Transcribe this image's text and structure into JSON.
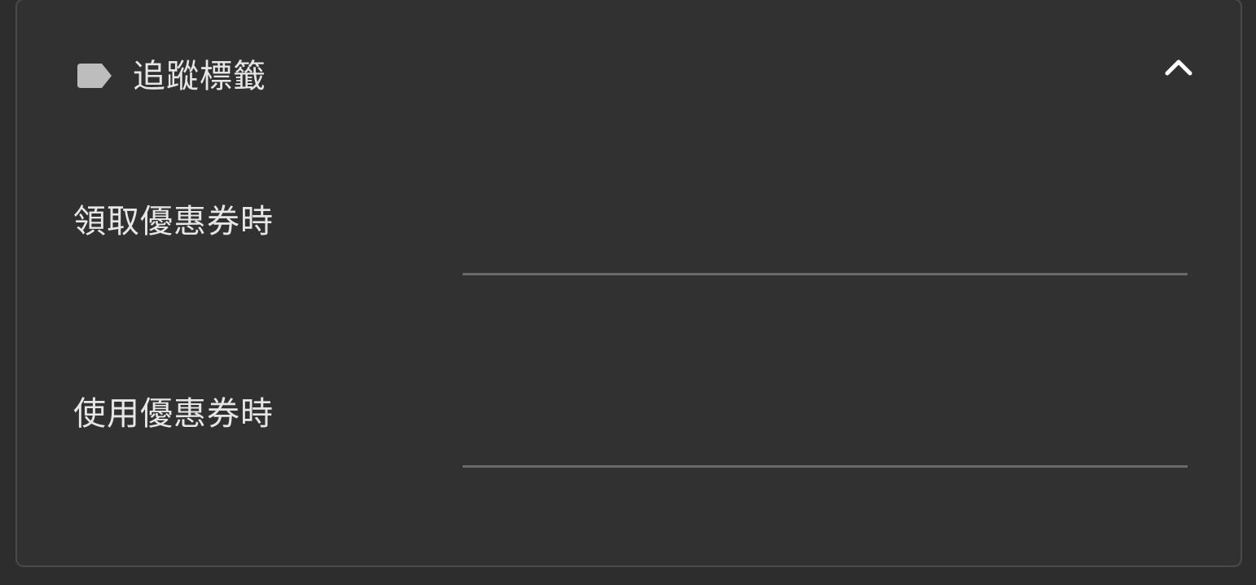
{
  "panel": {
    "title": "追蹤標籤",
    "icon": "label-tag-icon",
    "collapse_icon": "chevron-up-icon",
    "expanded": true
  },
  "fields": [
    {
      "label": "領取優惠券時",
      "value": "",
      "placeholder": ""
    },
    {
      "label": "使用優惠券時",
      "value": "",
      "placeholder": ""
    }
  ],
  "colors": {
    "background": "#2d2d2d",
    "panel": "#313131",
    "border": "#4a4a4a",
    "text": "#e6e6e6",
    "icon": "#bdbdbd",
    "underline": "#6a6a6a"
  }
}
